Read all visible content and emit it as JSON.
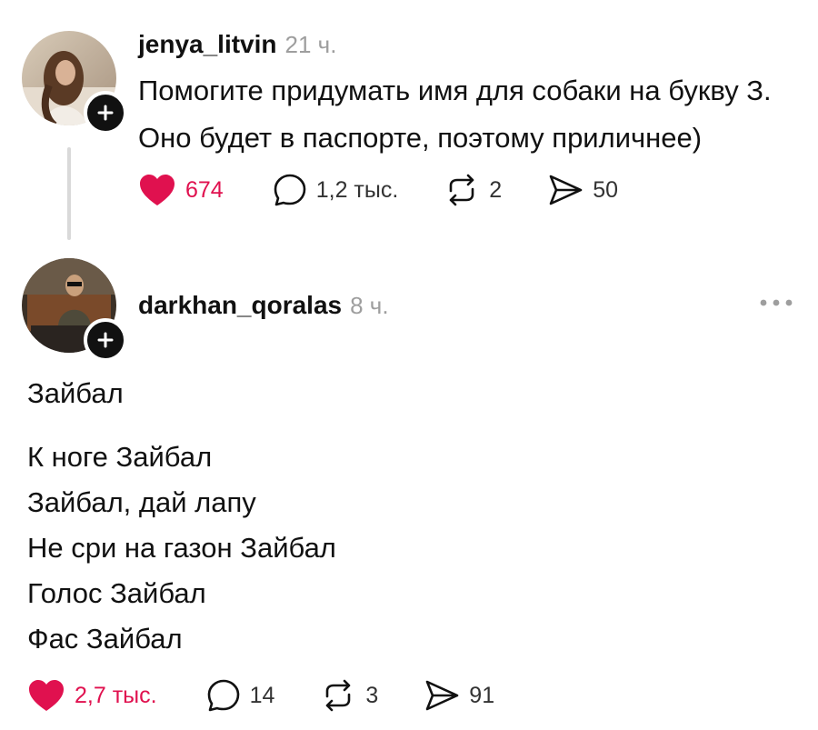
{
  "posts": [
    {
      "username": "jenya_litvin",
      "time": "21 ч.",
      "text": [
        "Помогите придумать имя для собаки на букву З.",
        "Оно будет в паспорте, поэтому приличнее)"
      ],
      "likes": "674",
      "comments": "1,2 тыс.",
      "reposts": "2",
      "shares": "50",
      "liked": true
    },
    {
      "username": "darkhan_qoralas",
      "time": "8 ч.",
      "text": [
        "Зайбал",
        "",
        "К ноге Зайбал",
        "Зайбал, дай лапу",
        "Не сри на газон Зайбал",
        "Голос Зайбал",
        "Фас Зайбал"
      ],
      "likes": "2,7 тыс.",
      "comments": "14",
      "reposts": "3",
      "shares": "91",
      "liked": true
    }
  ],
  "colors": {
    "like": "#e0114f",
    "muted": "#9e9e9e",
    "text": "#111111",
    "thread_line": "#d9d9d9"
  },
  "icons": {
    "like": "heart-icon",
    "comment": "comment-bubble-icon",
    "repost": "repost-icon",
    "share": "send-icon",
    "follow": "plus-icon",
    "more": "more-dots-icon"
  }
}
